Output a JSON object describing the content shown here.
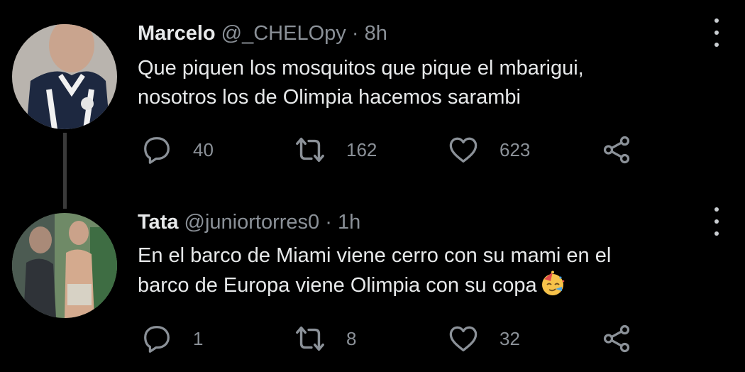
{
  "tweets": [
    {
      "name": "Marcelo",
      "handle": "@_CHELOpy",
      "separator": "·",
      "time": "8h",
      "text_line1": "Que piquen los mosquitos que pique el mbarigui,",
      "text_line2": "nosotros los de Olimpia hacemos sarambi",
      "replies": "40",
      "retweets": "162",
      "likes": "623"
    },
    {
      "name": "Tata",
      "handle": "@juniortorres0",
      "separator": "·",
      "time": "1h",
      "text_line1": "En el barco de Miami viene cerro con su mami en el",
      "text_line2": "barco de Europa viene Olimpia con su copa",
      "emoji": "partying-face-emoji",
      "replies": "1",
      "retweets": "8",
      "likes": "32"
    }
  ],
  "colors": {
    "background": "#000000",
    "text": "#e7e9ea",
    "muted": "#8b9198",
    "thread_line": "#3a3a3a"
  },
  "icons": [
    "reply-icon",
    "retweet-icon",
    "like-icon",
    "share-icon",
    "more-options-icon"
  ]
}
